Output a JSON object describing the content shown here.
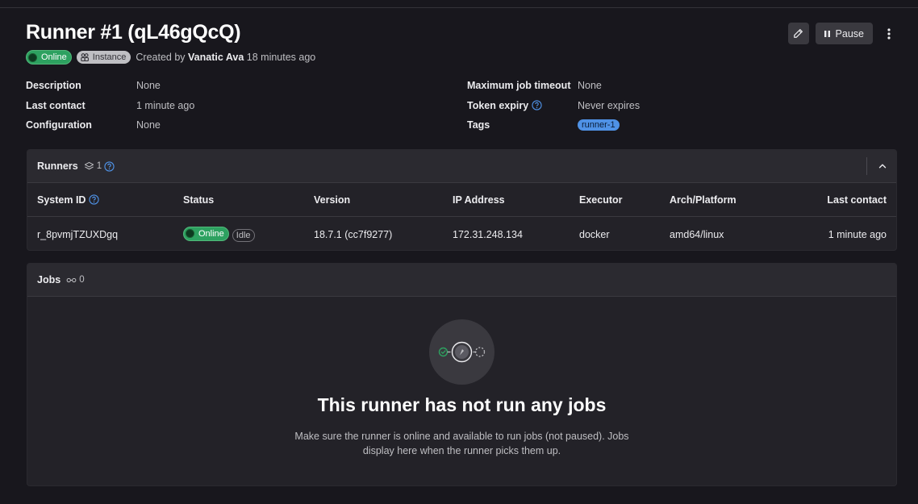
{
  "page": {
    "title": "Runner #1 (qL46gQcQ)",
    "status_badge": "Online",
    "type_badge": "Instance",
    "created_prefix": "Created by",
    "created_by": "Vanatic Ava",
    "created_ago": "18 minutes ago"
  },
  "actions": {
    "edit_icon": "pencil-icon",
    "pause_label": "Pause",
    "more_icon": "ellipsis-v-icon"
  },
  "details": {
    "left": [
      {
        "key": "Description",
        "value": "None"
      },
      {
        "key": "Last contact",
        "value": "1 minute ago"
      },
      {
        "key": "Configuration",
        "value": "None"
      }
    ],
    "right": [
      {
        "key": "Maximum job timeout",
        "value": "None"
      },
      {
        "key": "Token expiry",
        "value": "Never expires"
      },
      {
        "key": "Tags",
        "value": "runner-1"
      }
    ]
  },
  "runners": {
    "title": "Runners",
    "count": "1",
    "columns": [
      "System ID",
      "Status",
      "Version",
      "IP Address",
      "Executor",
      "Arch/Platform",
      "Last contact"
    ],
    "rows": [
      {
        "system_id": "r_8pvmjTZUXDgq",
        "status": "Online",
        "status_extra": "Idle",
        "version": "18.7.1 (cc7f9277)",
        "ip": "172.31.248.134",
        "executor": "docker",
        "arch": "amd64/linux",
        "last_contact": "1 minute ago"
      }
    ]
  },
  "jobs": {
    "title": "Jobs",
    "count": "0",
    "empty_title": "This runner has not run any jobs",
    "empty_desc": "Make sure the runner is online and available to run jobs (not paused). Jobs display here when the runner picks them up."
  },
  "colors": {
    "background": "#18171d",
    "online_green": "#2da160",
    "tag_blue": "#4f92e6"
  }
}
